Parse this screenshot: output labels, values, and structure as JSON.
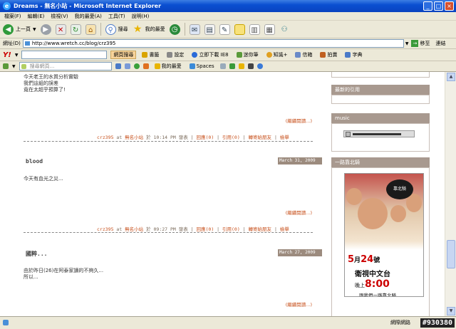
{
  "window": {
    "title": "Dreams - 無名小站 - Microsoft Internet Explorer"
  },
  "menu": [
    "檔案(F)",
    "編輯(E)",
    "檢視(V)",
    "我的最愛(A)",
    "工具(T)",
    "說明(H)"
  ],
  "toolbar": {
    "back": "上一頁",
    "search": "搜尋",
    "favorites": "我的最愛"
  },
  "address": {
    "label": "網址(D)",
    "url": "http://www.wretch.cc/blog/crz395",
    "go": "移至",
    "links": "連結"
  },
  "yahoo": {
    "logo": "Y!",
    "web_search": "網頁搜尋",
    "bookmarks": "書籤",
    "settings": "設定",
    "download": "立即下載 IE8",
    "notes": "迷你筆",
    "knowledge": "知識+",
    "mail": "信箱",
    "auction": "拍賣",
    "dictionary": "字典"
  },
  "searchbar": {
    "placeholder": "搜尋網頁...",
    "favorites": "我的最愛",
    "spaces": "Spaces"
  },
  "posts": [
    {
      "lines": [
        "今天老王的水質分析實驗",
        "我們這組的誤差",
        "竟在太超乎預算了!"
      ],
      "readmore": "(繼續閱讀...)",
      "meta": {
        "author": "crz395",
        "at": "at",
        "site": "無名小站",
        "on": "於",
        "time": "10:14 PM",
        "posted": "發表",
        "sep": "|",
        "reply": "回應(0)",
        "ref": "引用(0)",
        "forward": "轉寄給朋友",
        "report": "檢舉"
      }
    },
    {
      "title": "blood",
      "date": "March 31, 2009",
      "lines": [
        "今天有血光之災..."
      ],
      "readmore": "(繼續閱讀...)",
      "meta": {
        "author": "crz395",
        "at": "at",
        "site": "無名小站",
        "on": "於",
        "time": "09:27 PM",
        "posted": "發表",
        "sep": "|",
        "reply": "回應(0)",
        "ref": "引用(0)",
        "forward": "轉寄給朋友",
        "report": "檢舉"
      }
    },
    {
      "title": "國粹...",
      "date": "March 27, 2009",
      "lines": [
        "由於昨日(26)在阿泰家讀的不夠久...",
        "所以..."
      ],
      "readmore": "(繼續閱讀...)"
    }
  ],
  "sidebar": {
    "recent_refs": "最新的引用",
    "music": "music",
    "ride": "一路靠北騎"
  },
  "ad": {
    "date_num": "5",
    "date_month": "月",
    "date_day": "24",
    "date_weekday": "號",
    "channel": "衛視中文台",
    "time_prefix": "晚上",
    "time": "8:00",
    "slogan": "跟我們一路靠北騎",
    "badge": "靠北騎"
  },
  "status": {
    "zone": "網際網路",
    "id": "#930380"
  }
}
